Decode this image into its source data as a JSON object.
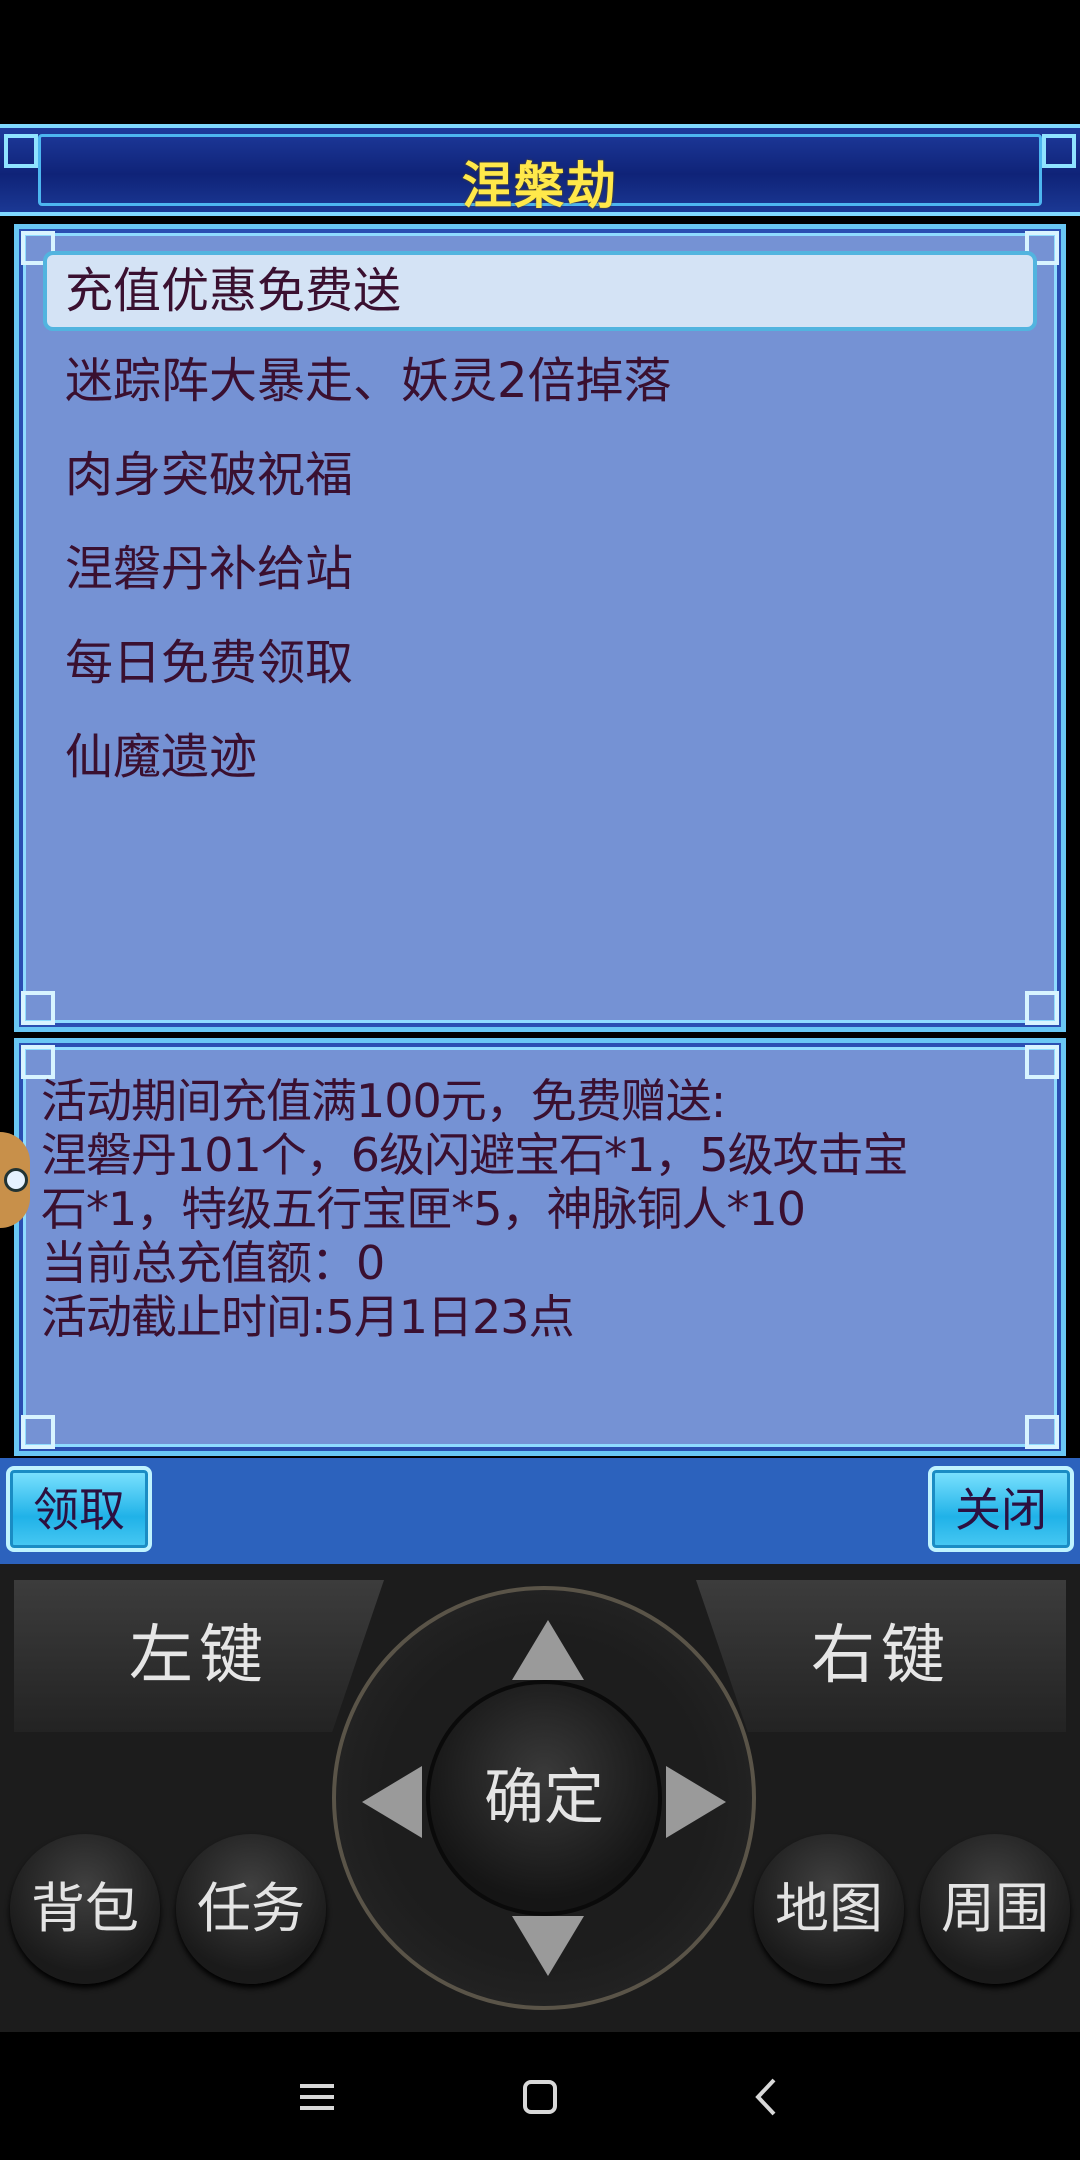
{
  "dialog": {
    "title": "涅槃劫",
    "menu_items": [
      "充值优惠免费送",
      "迷踪阵大暴走、妖灵2倍掉落",
      "肉身突破祝福",
      "涅磐丹补给站",
      "每日免费领取",
      "仙魔遗迹"
    ],
    "selected_index": 0,
    "description_lines": [
      "活动期间充值满100元，免费赠送:",
      "涅磐丹101个，6级闪避宝石*1，5级攻击宝",
      "石*1，特级五行宝匣*5，神脉铜人*10",
      "当前总充值额：0",
      "活动截止时间:5月1日23点"
    ],
    "claim_label": "领取",
    "close_label": "关闭"
  },
  "keypad": {
    "left_soft": "左键",
    "right_soft": "右键",
    "ok": "确定",
    "bag": "背包",
    "quest": "任务",
    "map": "地图",
    "nearby": "周围"
  },
  "colors": {
    "title_text": "#ffe84a",
    "panel_bg": "#7592d4",
    "border": "#69c7f4",
    "text": "#3a1030"
  }
}
